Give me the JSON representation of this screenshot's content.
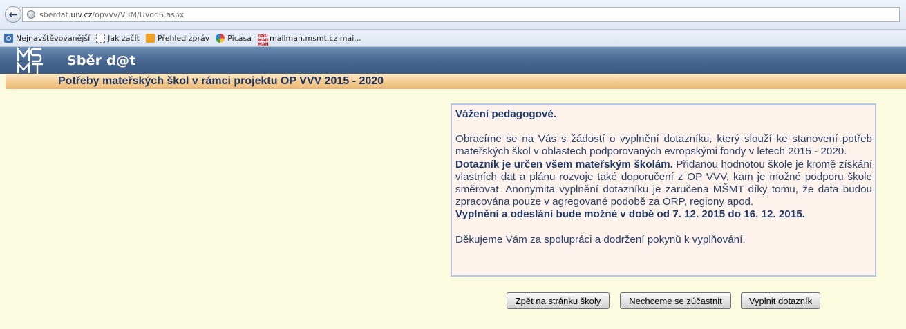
{
  "browser": {
    "url_host": "sberdat.",
    "url_domain": "uiv.cz",
    "url_path": "/opvvv/V3M/UvodS.aspx",
    "bookmarks": [
      {
        "label": "Nejnavštěvovanější",
        "icon": "favorites-icon"
      },
      {
        "label": "Jak začít",
        "icon": "page-icon"
      },
      {
        "label": "Přehled zpráv",
        "icon": "rss-icon"
      },
      {
        "label": "Picasa",
        "icon": "picasa-icon"
      },
      {
        "label": "mailman.msmt.cz mai...",
        "icon": "mailman-icon"
      }
    ]
  },
  "site": {
    "logo": "MŠMT",
    "title": "Sběr d@t"
  },
  "page": {
    "title": "Potřeby mateřských škol v rámci projektu OP VVV 2015 - 2020"
  },
  "info": {
    "greeting": "Vážení pedagogové.",
    "paragraph1": "Obracíme se na Vás s žádostí o vyplnění dotazníku, který slouží ke stanovení potřeb mateřských škol v oblastech podporovaných evropskými fondy v letech 2015 - 2020.",
    "target_bold": "Dotazník je určen všem mateřským školám.",
    "paragraph2": " Přidanou hodnotou škole je kromě získání vlastních dat a plánu rozvoje také doporučení z OP VVV, kam je možné podporu škole směrovat. Anonymita vyplnění dotazníku je zaručena MŠMT díky tomu, že data budou zpracována pouze v agregované podobě za ORP, regiony apod.",
    "deadline_bold": "Vyplnění a odeslání bude možné v době od 7. 12. 2015 do 16. 12. 2015.",
    "thanks": "Děkujeme Vám za spolupráci a dodržení pokynů k vyplňování."
  },
  "buttons": {
    "back": "Zpět na stránku školy",
    "decline": "Nechceme se zúčastnit",
    "fill": "Vyplnit dotazník"
  }
}
